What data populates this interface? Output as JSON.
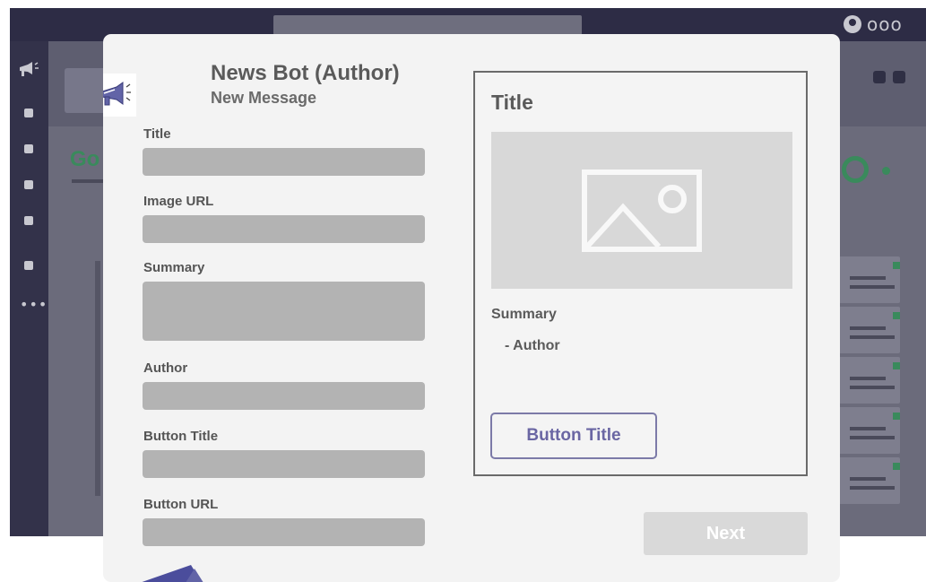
{
  "bot": {
    "name": "News Bot (Author)",
    "subtitle": "New Message"
  },
  "form": {
    "fields": [
      {
        "label": "Title",
        "value": ""
      },
      {
        "label": "Image URL",
        "value": ""
      },
      {
        "label": "Summary",
        "value": ""
      },
      {
        "label": "Author",
        "value": ""
      },
      {
        "label": "Button Title",
        "value": ""
      },
      {
        "label": "Button URL",
        "value": ""
      }
    ]
  },
  "preview": {
    "title": "Title",
    "image_icon": "image-placeholder-icon",
    "summary": "Summary",
    "author": "- Author",
    "button_label": "Button Title"
  },
  "actions": {
    "next_label": "Next",
    "next_enabled": false
  },
  "background": {
    "team_heading_fragment": "Go",
    "more_label": "•••",
    "title_bar_dots": "ooo"
  },
  "colors": {
    "accent": "#6264a7",
    "app_background": "#3f3f5b",
    "modal_background": "#f3f3f3",
    "field_fill": "#b3b3b3",
    "presence_green": "#3a8a5c"
  }
}
